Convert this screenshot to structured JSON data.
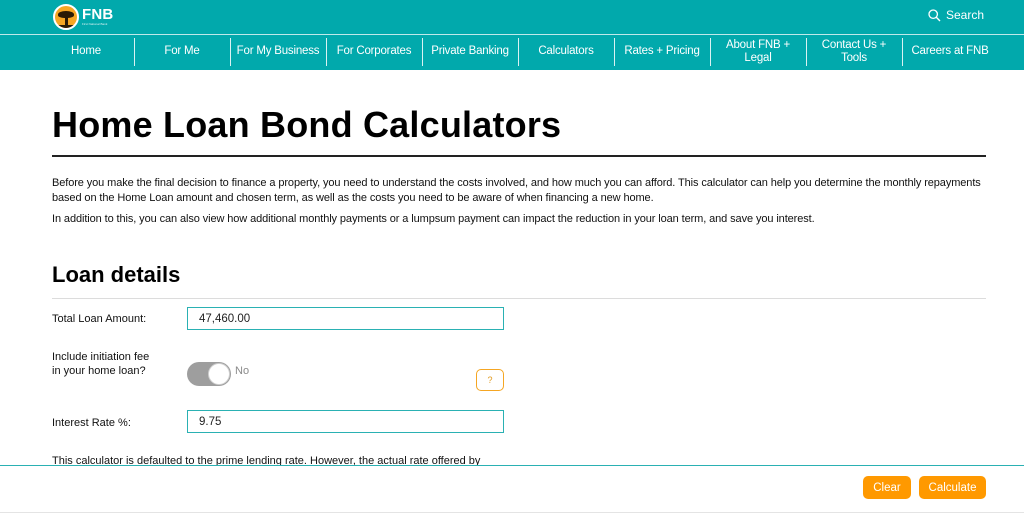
{
  "header": {
    "logo": {
      "brand": "FNB",
      "tagline": "First National Bank",
      "icon": "fnb-tree-logo-icon"
    },
    "search": {
      "label": "Search",
      "icon": "search-icon"
    },
    "colors": {
      "brand": "#01a9ac",
      "accent": "#ff9900"
    },
    "nav": [
      {
        "label": "Home"
      },
      {
        "label": "For Me"
      },
      {
        "label": "For My Business"
      },
      {
        "label": "For Corporates"
      },
      {
        "label": "Private Banking"
      },
      {
        "label": "Calculators"
      },
      {
        "label": "Rates + Pricing"
      },
      {
        "label": "About FNB + Legal"
      },
      {
        "label": "Contact Us + Tools"
      },
      {
        "label": "Careers at FNB"
      }
    ]
  },
  "page": {
    "title": "Home Loan Bond Calculators",
    "intro": [
      "Before you make the final decision to finance a property, you need to understand the costs involved, and how much you can afford. This calculator can help you determine the monthly repayments based on the Home Loan amount and chosen term, as well as the costs you need to be aware of when financing a new home.",
      "In addition to this, you can also view how additional monthly payments or a lumpsum payment can impact the reduction in your loan term, and save you interest."
    ]
  },
  "loan_details": {
    "title": "Loan details",
    "total_loan_amount": {
      "label": "Total Loan Amount:",
      "value": "47,460.00"
    },
    "initiation_fee": {
      "label_line1": "Include initiation fee",
      "label_line2": "in your home loan?",
      "state": "No",
      "enabled": false,
      "help": "?"
    },
    "interest_rate": {
      "label": "Interest Rate %:",
      "value": "9.75"
    },
    "rate_note": "This calculator is defaulted to the prime lending rate. However, the actual rate offered by"
  },
  "actions": {
    "clear": "Clear",
    "calculate": "Calculate"
  }
}
